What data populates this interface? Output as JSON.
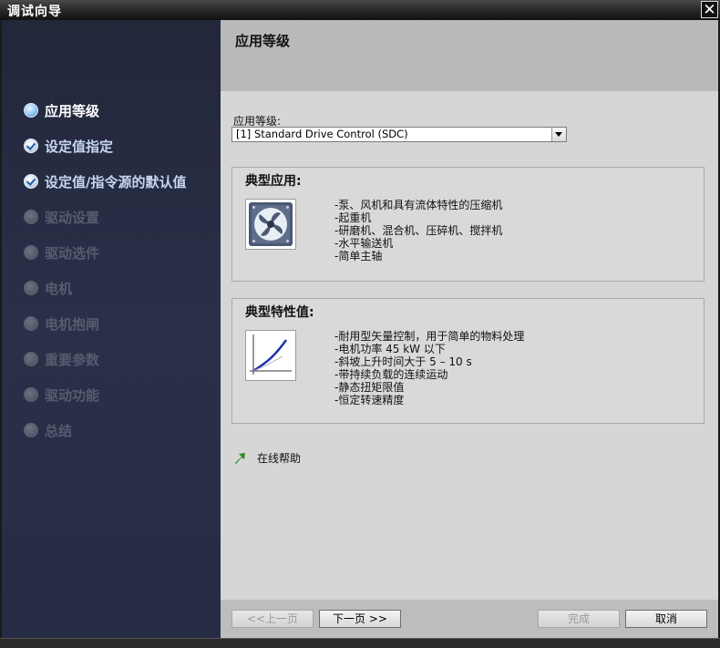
{
  "window": {
    "title": "调试向导",
    "close_symbol": "✕"
  },
  "sidebar": {
    "steps": [
      {
        "label": "应用等级",
        "state": "active"
      },
      {
        "label": "设定值指定",
        "state": "done"
      },
      {
        "label": "设定值/指令源的默认值",
        "state": "done"
      },
      {
        "label": "驱动设置",
        "state": "disabled"
      },
      {
        "label": "驱动选件",
        "state": "disabled"
      },
      {
        "label": "电机",
        "state": "disabled"
      },
      {
        "label": "电机抱闸",
        "state": "disabled"
      },
      {
        "label": "重要参数",
        "state": "disabled"
      },
      {
        "label": "驱动功能",
        "state": "disabled"
      },
      {
        "label": "总结",
        "state": "disabled"
      }
    ]
  },
  "header": {
    "title": "应用等级"
  },
  "form": {
    "app_class_label": "应用等级:",
    "app_class_value": "[1] Standard Drive Control (SDC)"
  },
  "typical_app": {
    "title": "典型应用:",
    "icon": "fan-icon",
    "items": [
      "-泵、风机和具有流体特性的压缩机",
      "-起重机",
      "-研磨机、混合机、压碎机、搅拌机",
      "-水平输送机",
      "-简单主轴"
    ]
  },
  "typical_char": {
    "title": "典型特性值:",
    "icon": "curve-chart-icon",
    "items": [
      "-耐用型矢量控制，用于简单的物料处理",
      "-电机功率 45 kW 以下",
      "-斜坡上升时间大于 5 – 10 s",
      "-带持续负载的连续运动",
      "-静态扭矩限值",
      "-恒定转速精度"
    ]
  },
  "help": {
    "label": "在线帮助",
    "icon": "arrow-up-right-icon",
    "color": "#2e8b2e"
  },
  "footer": {
    "prev": "<<上一页",
    "next": "下一页 >>",
    "finish": "完成",
    "cancel": "取消"
  }
}
